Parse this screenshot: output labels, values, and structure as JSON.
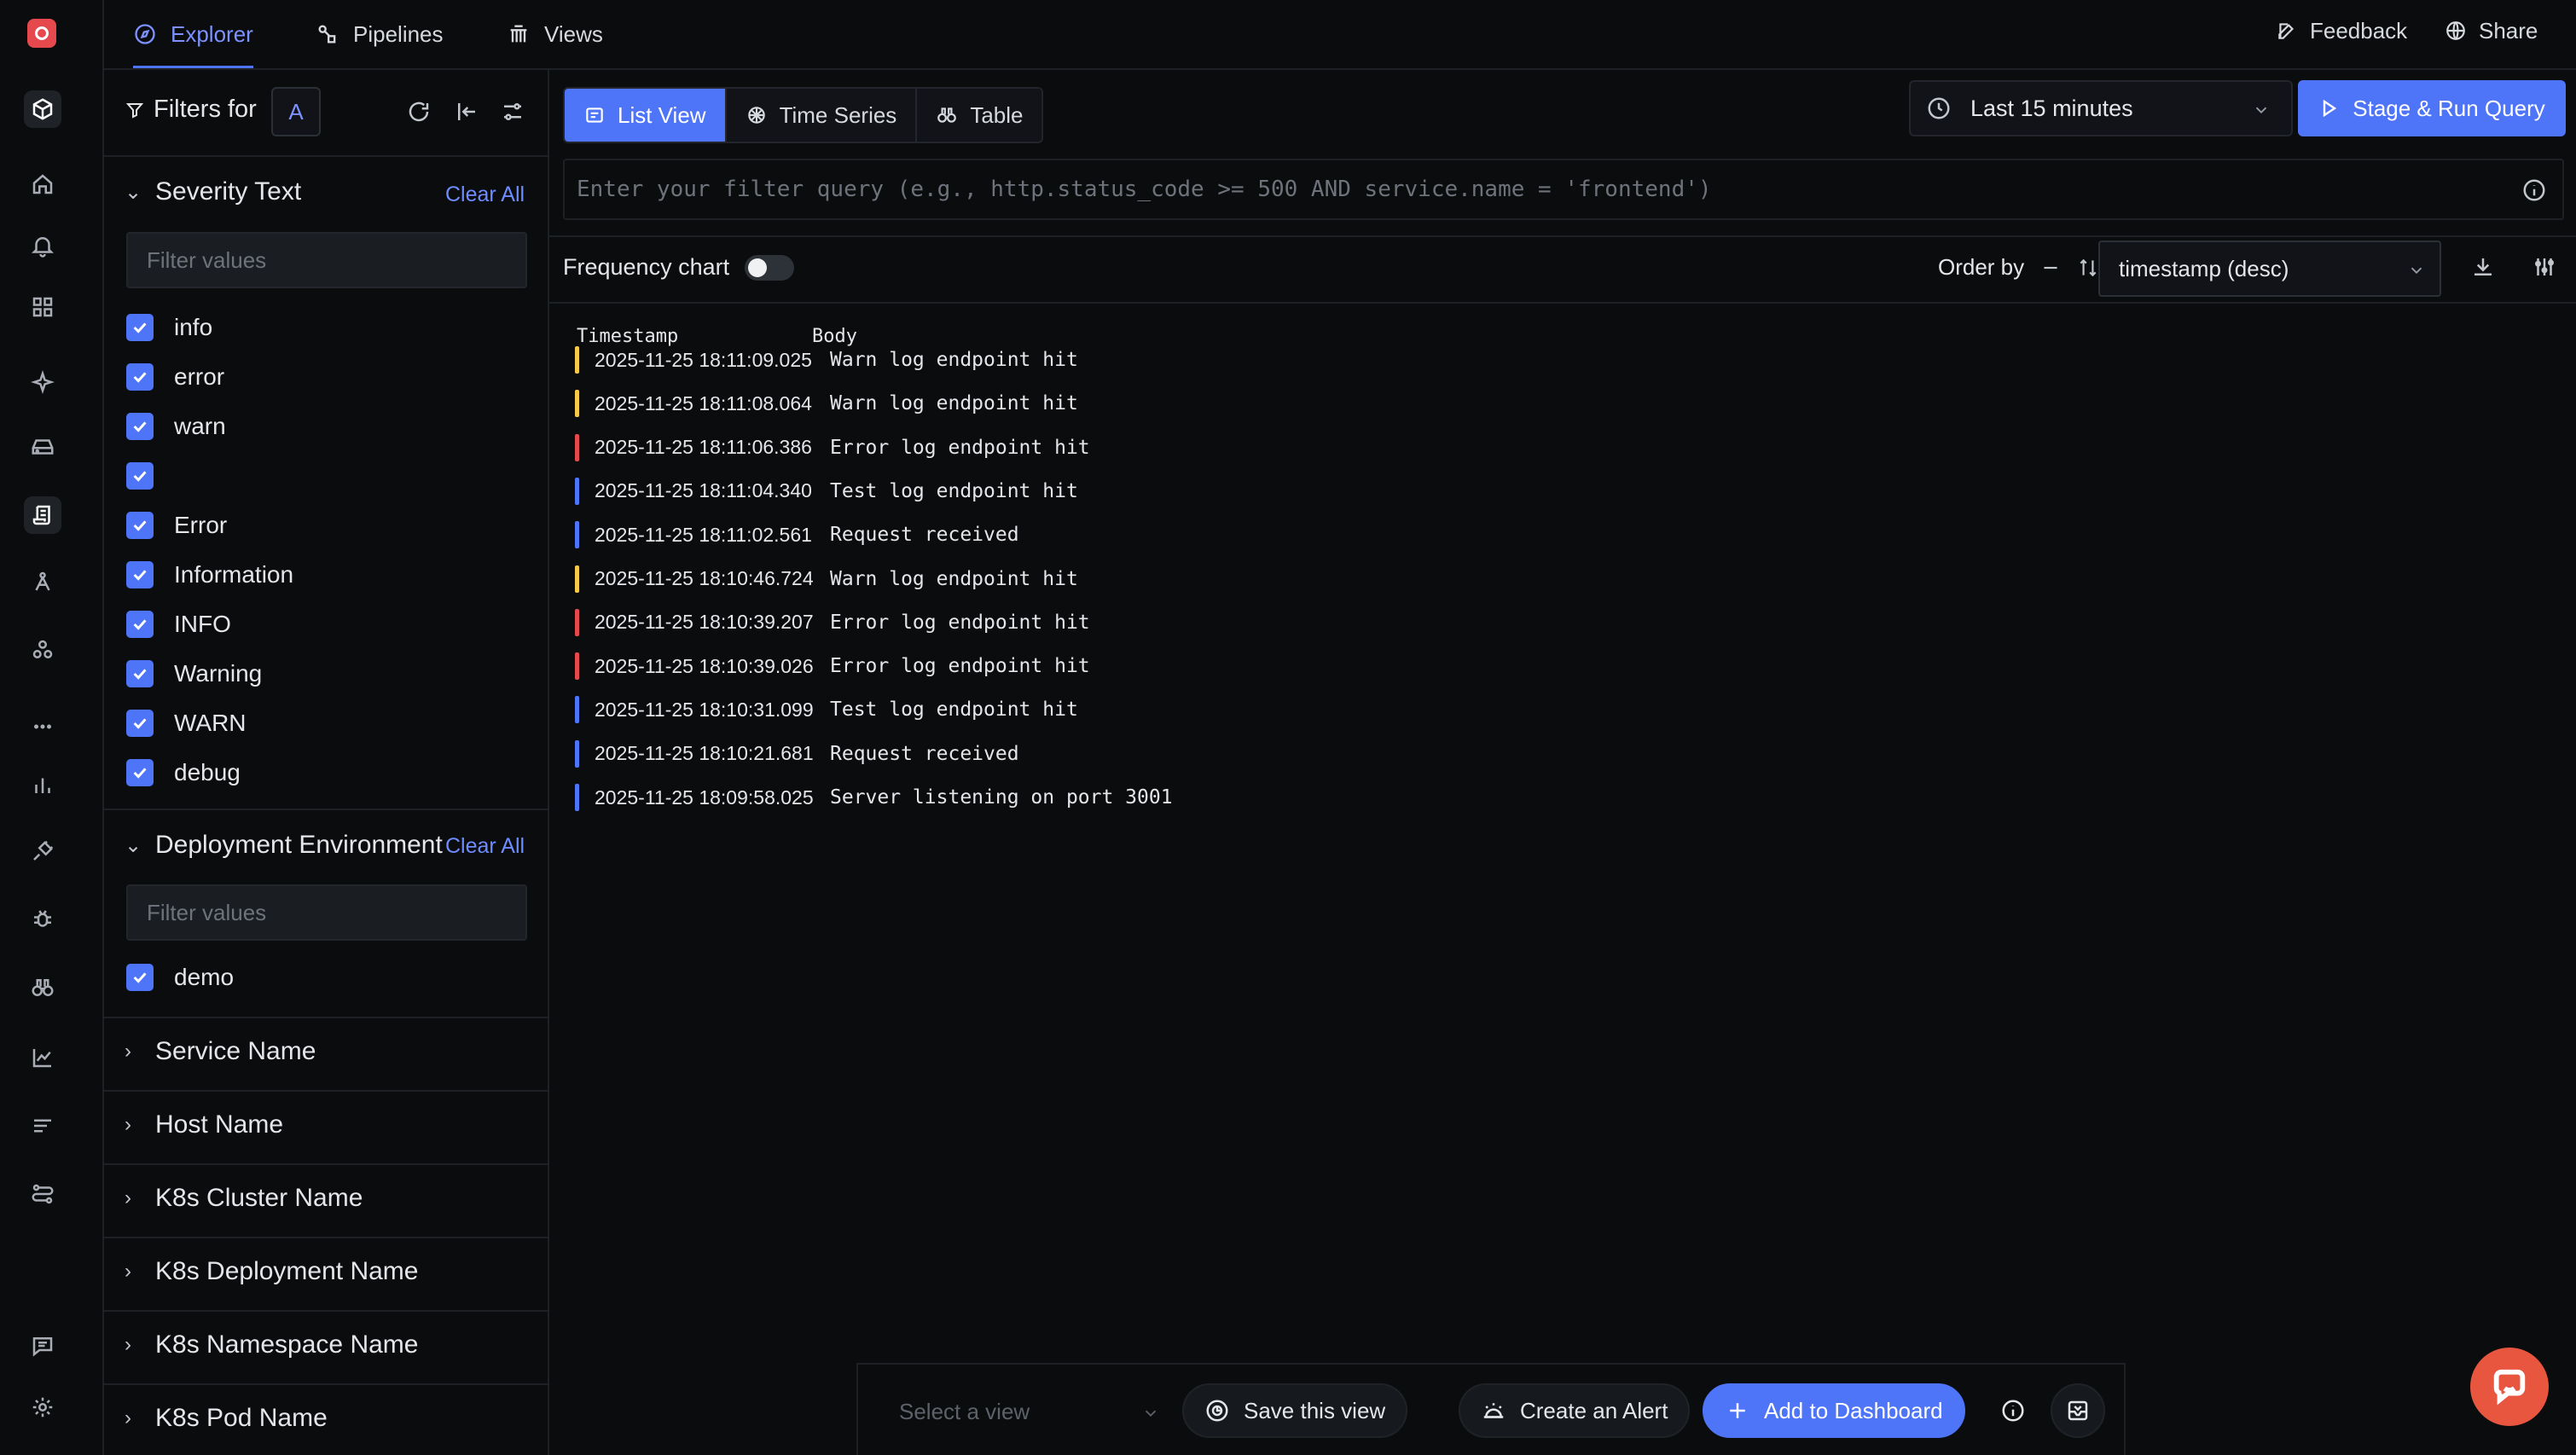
{
  "topnav": {
    "tabs": [
      {
        "label": "Explorer",
        "icon": "compass-icon",
        "active": true
      },
      {
        "label": "Pipelines",
        "icon": "pipeline-icon",
        "active": false
      },
      {
        "label": "Views",
        "icon": "views-icon",
        "active": false
      }
    ],
    "feedback": "Feedback",
    "share": "Share"
  },
  "filters": {
    "title": "Filters for",
    "query_badge": "A",
    "severity": {
      "title": "Severity Text",
      "clear_all": "Clear All",
      "placeholder": "Filter values",
      "items": [
        "info",
        "error",
        "warn",
        "",
        "Error",
        "Information",
        "INFO",
        "Warning",
        "WARN",
        "debug"
      ]
    },
    "deployment": {
      "title": "Deployment Environment",
      "clear_all": "Clear All",
      "placeholder": "Filter values",
      "items": [
        "demo"
      ]
    },
    "collapsed": [
      "Service Name",
      "Host Name",
      "K8s Cluster Name",
      "K8s Deployment Name",
      "K8s Namespace Name",
      "K8s Pod Name"
    ]
  },
  "main": {
    "view_tabs": [
      {
        "label": "List View",
        "active": true
      },
      {
        "label": "Time Series",
        "active": false
      },
      {
        "label": "Table",
        "active": false
      }
    ],
    "time_range": "Last 15 minutes",
    "run_button": "Stage & Run Query",
    "query_placeholder": "Enter your filter query (e.g., http.status_code >= 500 AND service.name = 'frontend')",
    "frequency_chart": "Frequency chart",
    "frequency_chart_on": false,
    "order_by_label": "Order by",
    "order_by_value": "timestamp (desc)",
    "columns": {
      "timestamp": "Timestamp",
      "body": "Body"
    },
    "logs": [
      {
        "ts": "2025-11-25 18:11:09.025",
        "body": "Warn log endpoint hit",
        "level": "warn"
      },
      {
        "ts": "2025-11-25 18:11:08.064",
        "body": "Warn log endpoint hit",
        "level": "warn"
      },
      {
        "ts": "2025-11-25 18:11:06.386",
        "body": "Error log endpoint hit",
        "level": "error"
      },
      {
        "ts": "2025-11-25 18:11:04.340",
        "body": "Test log endpoint hit",
        "level": "info"
      },
      {
        "ts": "2025-11-25 18:11:02.561",
        "body": "Request received",
        "level": "info"
      },
      {
        "ts": "2025-11-25 18:10:46.724",
        "body": "Warn log endpoint hit",
        "level": "warn"
      },
      {
        "ts": "2025-11-25 18:10:39.207",
        "body": "Error log endpoint hit",
        "level": "error"
      },
      {
        "ts": "2025-11-25 18:10:39.026",
        "body": "Error log endpoint hit",
        "level": "error"
      },
      {
        "ts": "2025-11-25 18:10:31.099",
        "body": "Test log endpoint hit",
        "level": "info"
      },
      {
        "ts": "2025-11-25 18:10:21.681",
        "body": "Request received",
        "level": "info"
      },
      {
        "ts": "2025-11-25 18:09:58.025",
        "body": "Server listening on port 3001",
        "level": "info"
      }
    ],
    "level_colors": {
      "warn": "#f7c948",
      "error": "#e5484d",
      "info": "#4e74f8"
    }
  },
  "bottombar": {
    "select_view_placeholder": "Select a view",
    "save_view": "Save this view",
    "create_alert": "Create an Alert",
    "add_dashboard": "Add to Dashboard"
  },
  "colors": {
    "accent": "#4e74f8",
    "link": "#6f8cff",
    "chat": "#e8563f"
  }
}
